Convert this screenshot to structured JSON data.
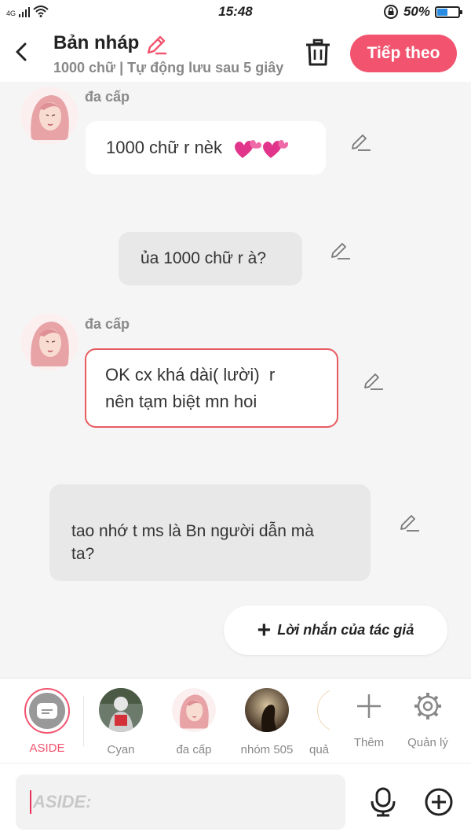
{
  "status_bar": {
    "network": "4G",
    "time": "15:48",
    "battery": "50%",
    "battery_level": 0.5
  },
  "header": {
    "title": "Bản nháp",
    "subtitle": "1000 chữ | Tự động lưu sau 5 giây",
    "next_label": "Tiếp theo"
  },
  "messages": [
    {
      "sender": "đa cấp",
      "text": "1000 chữ r nèk"
    },
    {
      "sender": "",
      "text": "ủa 1000 chữ r à?"
    },
    {
      "sender": "đa cấp",
      "text_line1": "OK cx khá dài( lười)  r",
      "text_line2": "nên tạm biệt mn hoi"
    },
    {
      "sender": "",
      "text_line1": "tao nhớ t ms là Bn người dẫn mà",
      "text_line2": "ta?"
    }
  ],
  "author_note": {
    "label": "Lời nhắn của tác giả"
  },
  "characters": [
    {
      "label": "ASIDE"
    },
    {
      "label": "Cyan"
    },
    {
      "label": "đa cấp"
    },
    {
      "label": "nhóm 505"
    },
    {
      "label": "quả"
    },
    {
      "label": "Thêm"
    },
    {
      "label": "Quản lý"
    }
  ],
  "input": {
    "placeholder": "ASIDE:"
  },
  "colors": {
    "accent": "#f2546f",
    "outline": "#e85b60",
    "selected_label": "#f2546f"
  },
  "icons": [
    "back-icon",
    "pencil-icon",
    "trash-icon",
    "plus-icon",
    "gear-icon",
    "mic-icon",
    "add-circle-icon",
    "heart-icon"
  ]
}
